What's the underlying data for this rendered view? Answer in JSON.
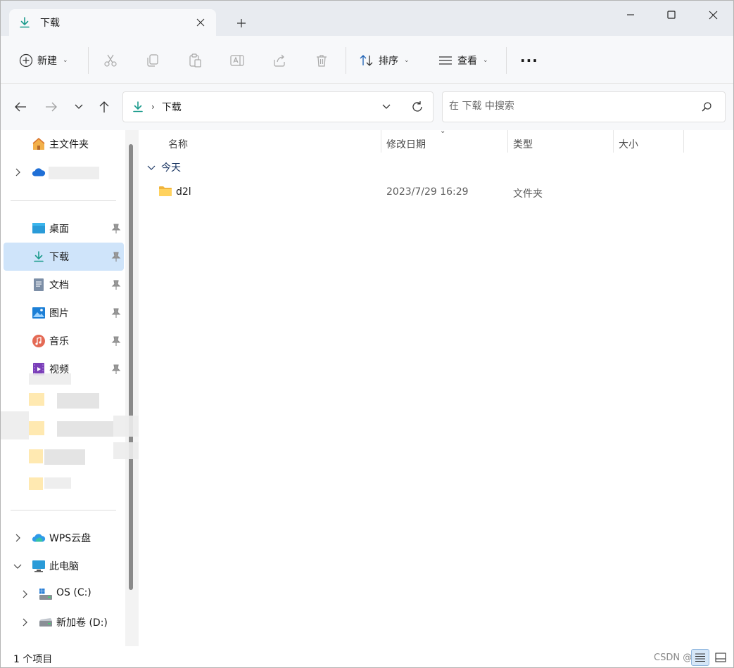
{
  "window": {
    "tab_title": "下载",
    "accent_color": "#1a9b8c",
    "window_controls": [
      "minimize-icon",
      "maximize-icon",
      "close-icon"
    ]
  },
  "commandbar": {
    "new_label": "新建",
    "sort_label": "排序",
    "view_label": "查看",
    "more_label": "···",
    "icons": [
      "cut-icon",
      "copy-icon",
      "paste-icon",
      "rename-icon",
      "share-icon",
      "delete-icon"
    ]
  },
  "address": {
    "path_separator": "›",
    "current_folder": "下载"
  },
  "search": {
    "placeholder": "在 下载 中搜索"
  },
  "sidebar": {
    "home": "主文件夹",
    "quick_access": [
      {
        "label": "桌面",
        "icon": "desktop-icon"
      },
      {
        "label": "下载",
        "icon": "download-icon"
      },
      {
        "label": "文档",
        "icon": "document-icon"
      },
      {
        "label": "图片",
        "icon": "pictures-icon"
      },
      {
        "label": "音乐",
        "icon": "music-icon"
      },
      {
        "label": "视频",
        "icon": "video-icon"
      }
    ],
    "wps": "WPS云盘",
    "this_pc": "此电脑",
    "drives": [
      "OS (C:)",
      "新加卷 (D:)"
    ]
  },
  "content": {
    "columns": [
      "名称",
      "修改日期",
      "类型",
      "大小"
    ],
    "group": "今天",
    "files": [
      {
        "name": "d2l",
        "modified": "2023/7/29 16:29",
        "type": "文件夹",
        "size": ""
      }
    ]
  },
  "statusbar": {
    "item_count": "1 个项目",
    "watermark": "CSDN @",
    "view_modes": [
      "details-view-icon",
      "tiles-view-icon"
    ]
  }
}
